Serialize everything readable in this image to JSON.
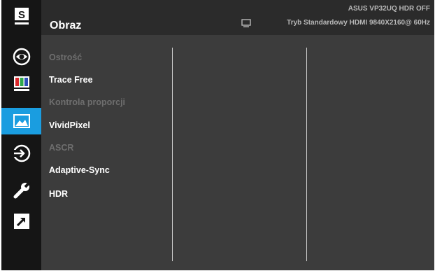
{
  "header": {
    "title": "Obraz",
    "info_line1": "ASUS  VP32UQ  HDR OFF",
    "info_line2": "Tryb Standardowy HDMI 9840X2160@ 60Hz"
  },
  "sidebar": {
    "items": [
      {
        "icon": "splendid-s-icon",
        "label": "S"
      },
      {
        "icon": "eye-care-icon"
      },
      {
        "icon": "color-bars-icon"
      },
      {
        "icon": "image-icon",
        "active": true
      },
      {
        "icon": "input-select-icon"
      },
      {
        "icon": "wrench-icon"
      },
      {
        "icon": "shortcut-arrow-icon"
      }
    ]
  },
  "menu": {
    "items": [
      {
        "label": "Ostrość",
        "enabled": false
      },
      {
        "label": "Trace Free",
        "enabled": true
      },
      {
        "label": "Kontrola proporcji",
        "enabled": false
      },
      {
        "label": "VividPixel",
        "enabled": true
      },
      {
        "label": "ASCR",
        "enabled": false
      },
      {
        "label": "Adaptive-Sync",
        "enabled": true
      },
      {
        "label": "HDR",
        "enabled": true
      }
    ]
  },
  "colors": {
    "accent": "#1a9de0",
    "background": "#3c3c3c",
    "sidebar": "#151515",
    "header": "#2b2b2b",
    "text_enabled": "#ffffff",
    "text_disabled": "#6e6e6e"
  }
}
